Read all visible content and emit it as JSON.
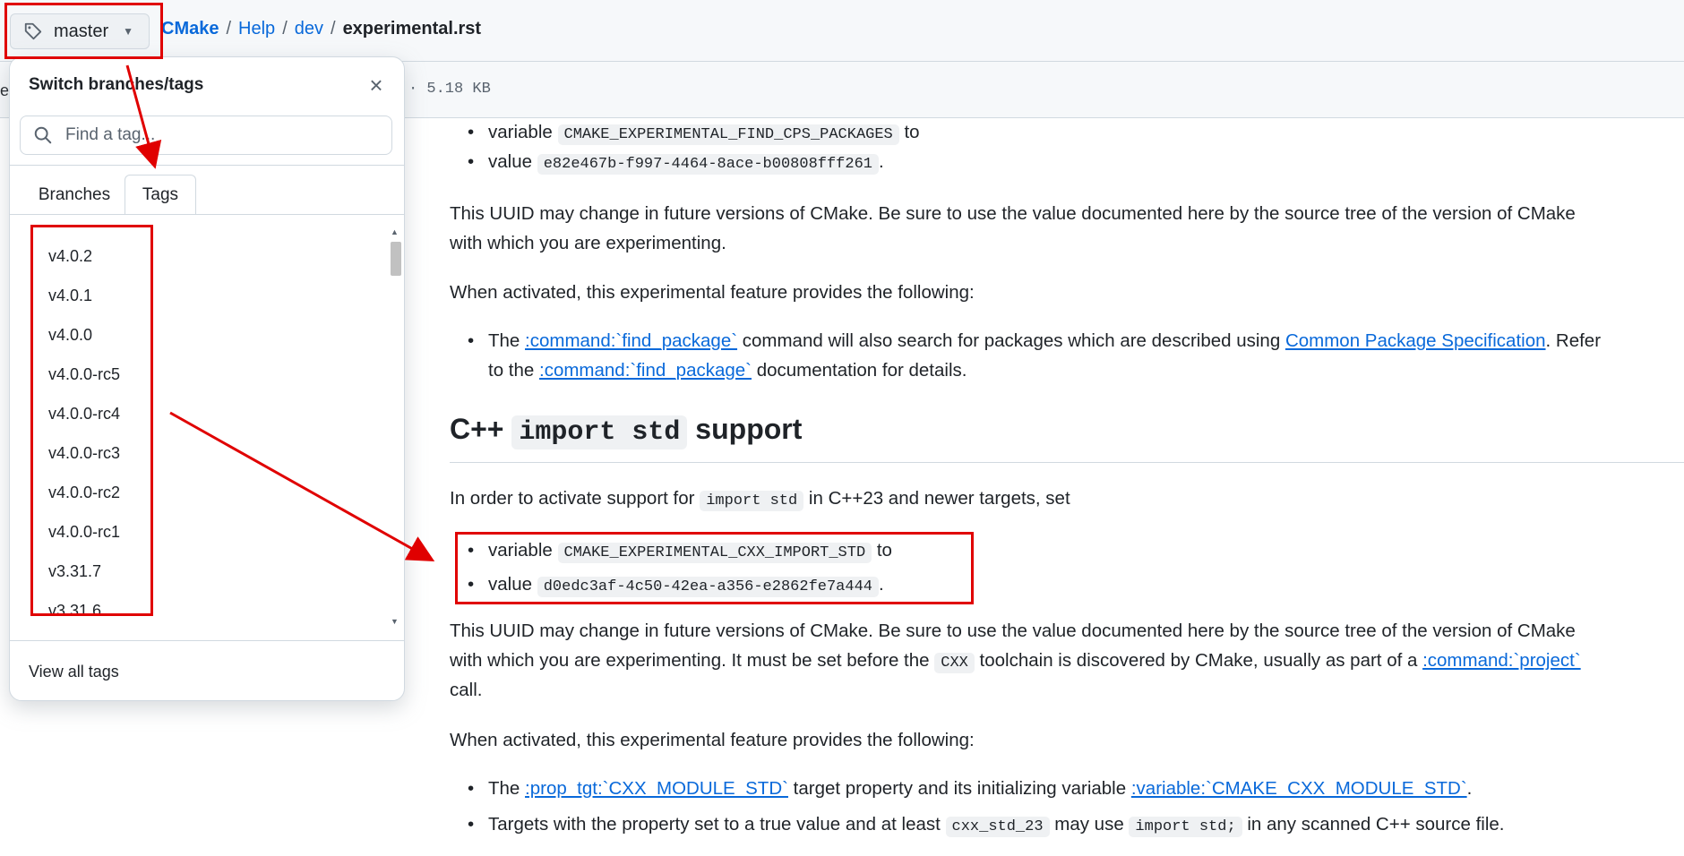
{
  "header": {
    "branch_label": "master",
    "breadcrumb": {
      "root": "CMake",
      "sep": "/",
      "parts": [
        "Help",
        "dev"
      ],
      "file": "experimental.rst"
    }
  },
  "file_bar": {
    "left_stub": "e",
    "size": "· 5.18 KB"
  },
  "dropdown": {
    "title": "Switch branches/tags",
    "search_placeholder": "Find a tag...",
    "tabs": [
      "Branches",
      "Tags"
    ],
    "active_tab": "Tags",
    "tags": [
      "v4.0.2",
      "v4.0.1",
      "v4.0.0",
      "v4.0.0-rc5",
      "v4.0.0-rc4",
      "v4.0.0-rc3",
      "v4.0.0-rc2",
      "v4.0.0-rc1",
      "v3.31.7",
      "v3.31.6"
    ],
    "footer": "View all tags"
  },
  "content": {
    "bullets1": [
      {
        "text": "variable ",
        "code": "CMAKE_EXPERIMENTAL_FIND_CPS_PACKAGES",
        "after": " to"
      },
      {
        "text": "value ",
        "code": "e82e467b-f997-4464-8ace-b00808fff261",
        "after": "."
      }
    ],
    "uuid_para_1": "This UUID may change in future versions of CMake. Be sure to use the value documented here by the source tree of the version of CMake",
    "uuid_para_2": "with which you are experimenting.",
    "activated_1": "When activated, this experimental feature provides the following:",
    "cps_bullet": {
      "pre": "The ",
      "link1": ":command:`find_package`",
      "mid": " command will also search for packages which are described using ",
      "link2": "Common Package Specification",
      "post": ". Refer",
      "line2_pre": "to the ",
      "link3": ":command:`find_package`",
      "line2_post": " documentation for details."
    },
    "heading": {
      "pre": "C++ ",
      "code": "import std",
      "post": " support"
    },
    "activate_para": {
      "pre": "In order to activate support for ",
      "code": "import std",
      "post": " in C++23 and newer targets, set"
    },
    "bullets2": [
      {
        "text": "variable ",
        "code": "CMAKE_EXPERIMENTAL_CXX_IMPORT_STD",
        "after": " to"
      },
      {
        "text": "value ",
        "code": "d0edc3af-4c50-42ea-a356-e2862fe7a444",
        "after": "."
      }
    ],
    "uuid2_line1": "This UUID may change in future versions of CMake. Be sure to use the value documented here by the source tree of the version of CMake",
    "uuid2_line2": {
      "pre": "with which you are experimenting. It must be set before the ",
      "code": "CXX",
      "mid": " toolchain is discovered by CMake, usually as part of a ",
      "link": ":command:`project`"
    },
    "uuid2_line3": "call.",
    "activated_2": "When activated, this experimental feature provides the following:",
    "bullets3": [
      {
        "pre": "The ",
        "link1": ":prop_tgt:`CXX_MODULE_STD`",
        "mid": " target property and its initializing variable ",
        "link2": ":variable:`CMAKE_CXX_MODULE_STD`",
        "post": "."
      },
      {
        "pre": "Targets with the property set to a true value and at least ",
        "code1": "cxx_std_23",
        "mid": " may use ",
        "code2": "import std;",
        "post": " in any scanned C++ source file."
      }
    ]
  },
  "colors": {
    "link": "#0969da",
    "annotation": "#e00000",
    "text": "#1f2328"
  }
}
